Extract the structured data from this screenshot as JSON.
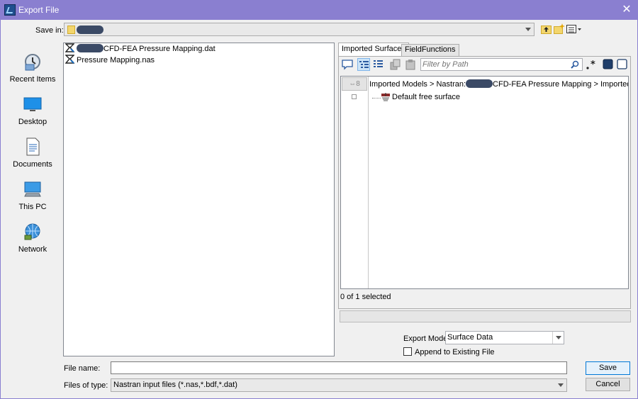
{
  "window": {
    "title": "Export File"
  },
  "save_in": {
    "label": "Save in:"
  },
  "places": [
    {
      "label": "Recent Items"
    },
    {
      "label": "Desktop"
    },
    {
      "label": "Documents"
    },
    {
      "label": "This PC"
    },
    {
      "label": "Network"
    }
  ],
  "files": [
    {
      "name": "CFD-FEA Pressure Mapping.dat"
    },
    {
      "name": "Pressure Mapping.nas"
    }
  ],
  "tabs": [
    {
      "label": "Imported Surfaces"
    },
    {
      "label": "FieldFunctions"
    }
  ],
  "filter": {
    "placeholder": "Filter by Path"
  },
  "tree": {
    "path_prefix": "Imported Models > Nastran:",
    "path_suffix": "CFD-FEA Pressure Mapping > Imported Eleme...",
    "items": [
      {
        "label": "Default free surface"
      }
    ]
  },
  "selection_status": "0 of 1 selected",
  "export_mode": {
    "label": "Export Mode",
    "value": "Surface Data"
  },
  "append": {
    "label": "Append to Existing File",
    "checked": false
  },
  "file_name": {
    "label": "File name:",
    "value": ""
  },
  "files_of_type": {
    "label": "Files of type:",
    "value": "Nastran input files (*.nas,*.bdf,*.dat)"
  },
  "buttons": {
    "save": "Save",
    "cancel": "Cancel"
  },
  "colors": {
    "titlebar": "#8a7fd0",
    "selection": "#cce4f7",
    "folder": "#f3d66d"
  }
}
